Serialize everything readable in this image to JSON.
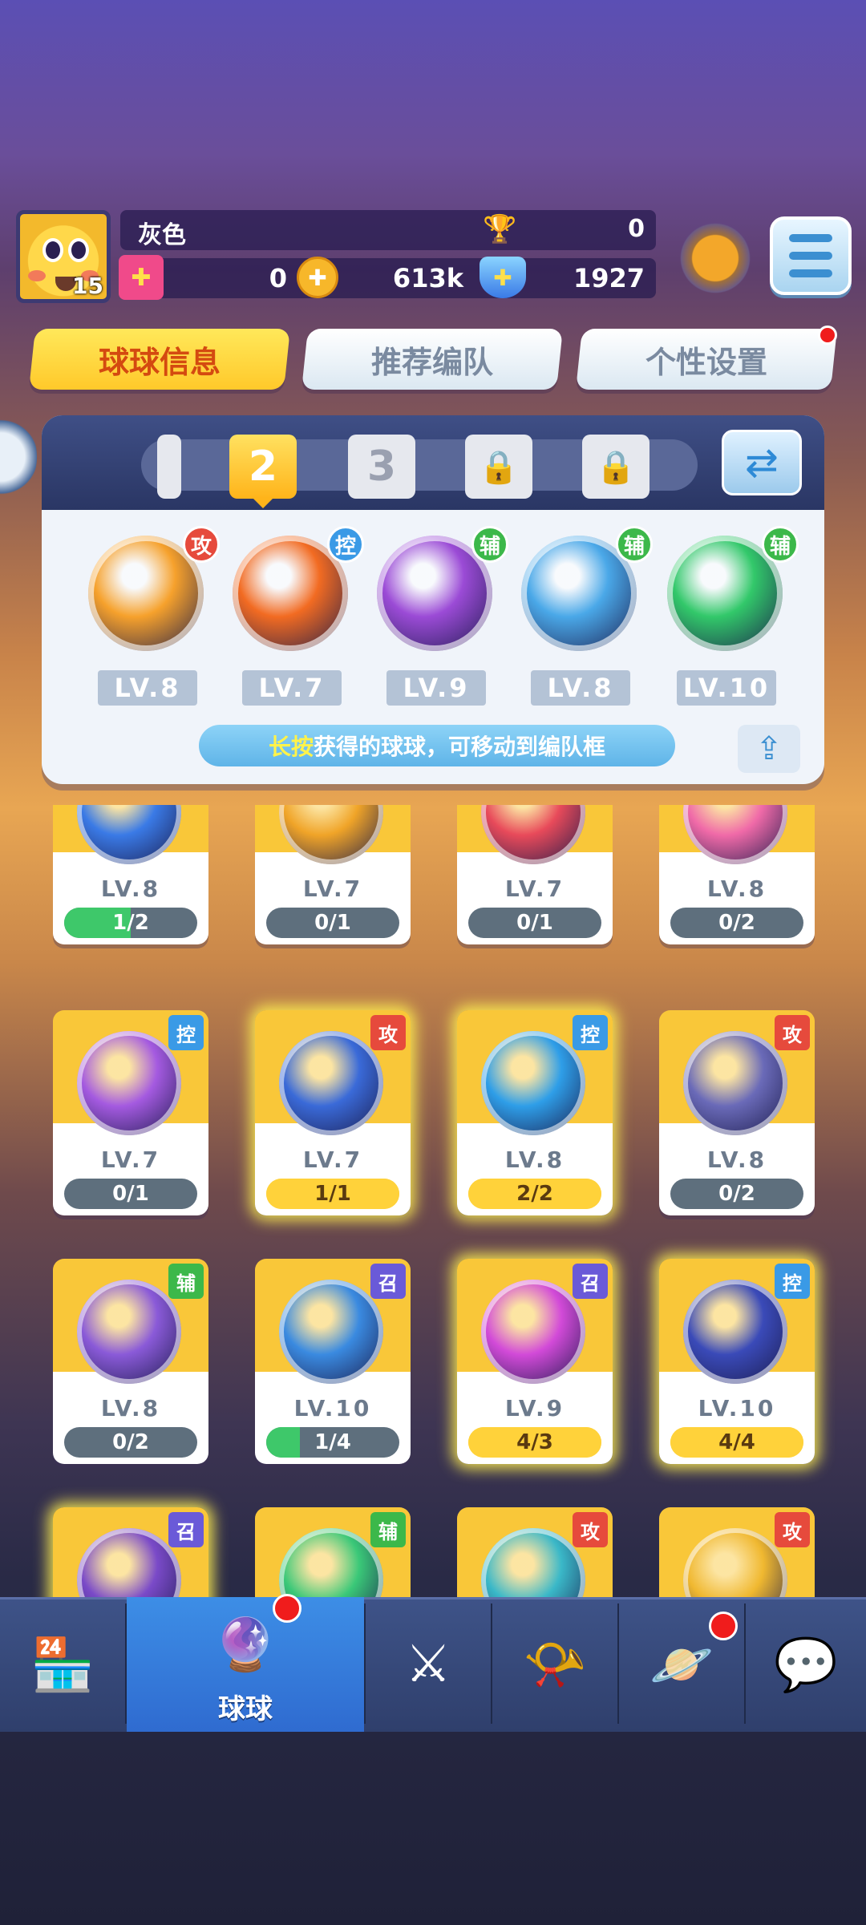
{
  "player": {
    "avatar_level": "15",
    "name": "灰色",
    "trophies": "0",
    "tickets": "0",
    "gold": "613k",
    "gems": "1927"
  },
  "tabs": [
    {
      "label": "球球信息"
    },
    {
      "label": "推荐编队"
    },
    {
      "label": "个性设置"
    }
  ],
  "team_slots": [
    {
      "label": ""
    },
    {
      "label": "2"
    },
    {
      "label": "3"
    },
    {
      "label": "locked-icon"
    },
    {
      "label": "locked-icon"
    }
  ],
  "team": [
    {
      "type": "攻",
      "level": "LV.8",
      "color": "#f6a12c",
      "badge": "#e64a3c"
    },
    {
      "type": "控",
      "level": "LV.7",
      "color": "#f26b22",
      "badge": "#3a9ae6"
    },
    {
      "type": "辅",
      "level": "LV.9",
      "color": "#9b4bd6",
      "badge": "#3cb84a"
    },
    {
      "type": "辅",
      "level": "LV.8",
      "color": "#4aa8e8",
      "badge": "#3cb84a"
    },
    {
      "type": "辅",
      "level": "LV.10",
      "color": "#32c86a",
      "badge": "#3cb84a"
    }
  ],
  "hint": {
    "highlight": "长按",
    "text": "获得的球球，可移动到编队框"
  },
  "cards": [
    {
      "type": "",
      "level": "LV.8",
      "progress": "1/2",
      "fill": 0.5,
      "color": "#3a7ae6",
      "badge": "",
      "style": "gray",
      "glow": false
    },
    {
      "type": "",
      "level": "LV.7",
      "progress": "0/1",
      "fill": 0,
      "color": "#f0a428",
      "badge": "",
      "style": "gray",
      "glow": false
    },
    {
      "type": "",
      "level": "LV.7",
      "progress": "0/1",
      "fill": 0,
      "color": "#e84a5a",
      "badge": "",
      "style": "gray",
      "glow": false
    },
    {
      "type": "",
      "level": "LV.8",
      "progress": "0/2",
      "fill": 0,
      "color": "#f06aa8",
      "badge": "",
      "style": "gray",
      "glow": false
    },
    {
      "type": "控",
      "level": "LV.7",
      "progress": "0/1",
      "fill": 0,
      "color": "#a45ae0",
      "badge": "#3a9ae6",
      "style": "gray",
      "glow": false
    },
    {
      "type": "攻",
      "level": "LV.7",
      "progress": "1/1",
      "fill": 1,
      "color": "#3a6ad8",
      "badge": "#e64a3c",
      "style": "yellow",
      "glow": true
    },
    {
      "type": "控",
      "level": "LV.8",
      "progress": "2/2",
      "fill": 1,
      "color": "#2e9ee8",
      "badge": "#3a9ae6",
      "style": "yellow",
      "glow": true
    },
    {
      "type": "攻",
      "level": "LV.8",
      "progress": "0/2",
      "fill": 0,
      "color": "#6a6ab8",
      "badge": "#e64a3c",
      "style": "gray",
      "glow": false
    },
    {
      "type": "辅",
      "level": "LV.8",
      "progress": "0/2",
      "fill": 0,
      "color": "#8a5ad8",
      "badge": "#3cb84a",
      "style": "gray",
      "glow": false
    },
    {
      "type": "召",
      "level": "LV.10",
      "progress": "1/4",
      "fill": 0.25,
      "color": "#3a8ae0",
      "badge": "#6a5ad8",
      "style": "gray",
      "glow": false
    },
    {
      "type": "召",
      "level": "LV.9",
      "progress": "4/3",
      "fill": 1,
      "color": "#d24ad8",
      "badge": "#6a5ad8",
      "style": "yellow",
      "glow": true
    },
    {
      "type": "控",
      "level": "LV.10",
      "progress": "4/4",
      "fill": 1,
      "color": "#3a4ab8",
      "badge": "#3a9ae6",
      "style": "yellow",
      "glow": true
    },
    {
      "type": "召",
      "level": "",
      "progress": "",
      "fill": 0,
      "color": "#7a4ac8",
      "badge": "#6a5ad8",
      "style": "gray",
      "glow": true
    },
    {
      "type": "辅",
      "level": "",
      "progress": "",
      "fill": 0,
      "color": "#3ac878",
      "badge": "#3cb84a",
      "style": "gray",
      "glow": false
    },
    {
      "type": "攻",
      "level": "",
      "progress": "",
      "fill": 0,
      "color": "#3ab8c8",
      "badge": "#e64a3c",
      "style": "gray",
      "glow": false
    },
    {
      "type": "攻",
      "level": "",
      "progress": "",
      "fill": 0,
      "color": "#f0b830",
      "badge": "#e64a3c",
      "style": "gray",
      "glow": false
    }
  ],
  "nav": [
    {
      "icon": "shop-icon",
      "label": ""
    },
    {
      "icon": "ball-icon",
      "label": "球球",
      "active": true
    },
    {
      "icon": "swords-icon",
      "label": ""
    },
    {
      "icon": "whistle-icon",
      "label": ""
    },
    {
      "icon": "planet-icon",
      "label": ""
    },
    {
      "icon": "chat-icon",
      "label": ""
    }
  ],
  "colors": {
    "accent_yellow": "#ffc92a",
    "tab_active_text": "#d44a10",
    "progress_green": "#3ec86a",
    "progress_yellow": "#ffd23a",
    "progress_gray": "#5e6f7d"
  }
}
